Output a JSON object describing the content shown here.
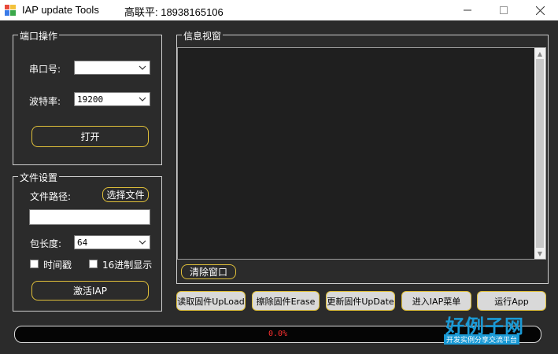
{
  "window": {
    "title": "IAP update Tools",
    "title_extra": "高联平: 18938165106",
    "minimize_icon": "minimize-icon",
    "maximize_icon": "maximize-icon",
    "close_icon": "close-icon"
  },
  "port_group": {
    "title": "端口操作",
    "port_label": "串口号:",
    "port_value": "",
    "baud_label": "波特率:",
    "baud_value": "19200",
    "open_button": "打开"
  },
  "file_group": {
    "title": "文件设置",
    "path_label": "文件路径:",
    "select_file_button": "选择文件",
    "path_value": "",
    "packet_label": "包长度:",
    "packet_value": "64",
    "timestamp_label": "时间戳",
    "hex_label": "16进制显示",
    "activate_button": "激活IAP"
  },
  "info_group": {
    "title": "信息视窗",
    "clear_button": "清除窗口"
  },
  "actions": [
    "读取固件UpLoad",
    "擦除固件Erase",
    "更新固件UpDate",
    "进入IAP菜单",
    "运行App"
  ],
  "progress": {
    "text": "0.0%",
    "value": 0
  },
  "watermark": {
    "main": "好例子网",
    "sub": "开发实例分享交流平台"
  },
  "colors": {
    "background": "#2b2b2b",
    "accent_border": "#e0c03a",
    "progress_text": "#ff3030",
    "watermark": "#1a9ad6"
  }
}
